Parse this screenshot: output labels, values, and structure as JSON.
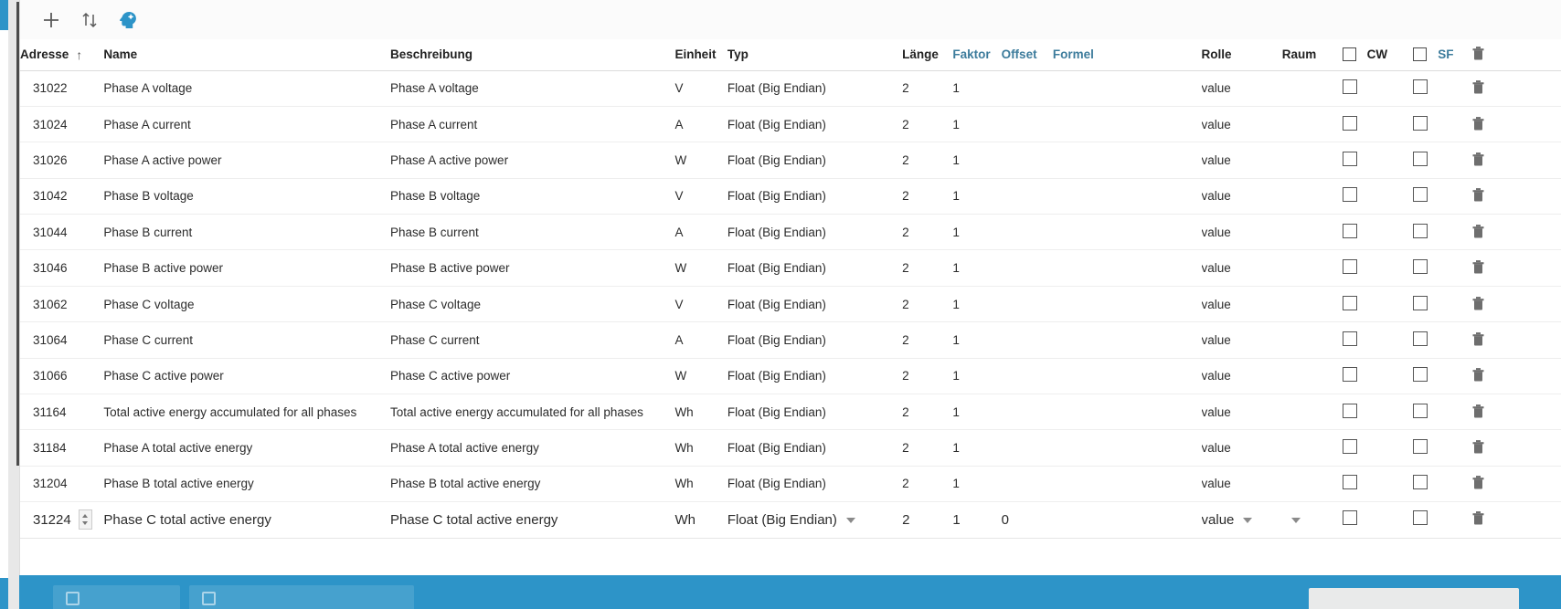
{
  "toolbar": {
    "add_label": "+",
    "sort_label": "sort-updown",
    "ai_label": "ai-head"
  },
  "table": {
    "headers": {
      "adresse": "Adresse",
      "name": "Name",
      "beschreibung": "Beschreibung",
      "einheit": "Einheit",
      "typ": "Typ",
      "laenge": "Länge",
      "faktor": "Faktor",
      "offset": "Offset",
      "formel": "Formel",
      "rolle": "Rolle",
      "raum": "Raum",
      "cw": "CW",
      "sf": "SF",
      "sort_indicator": "↑"
    },
    "rows": [
      {
        "adresse": "31022",
        "name": "Phase A voltage",
        "beschreibung": "Phase A voltage",
        "einheit": "V",
        "typ": "Float (Big Endian)",
        "laenge": "2",
        "faktor": "1",
        "offset": "",
        "formel": "",
        "rolle": "value",
        "raum": ""
      },
      {
        "adresse": "31024",
        "name": "Phase A current",
        "beschreibung": "Phase A current",
        "einheit": "A",
        "typ": "Float (Big Endian)",
        "laenge": "2",
        "faktor": "1",
        "offset": "",
        "formel": "",
        "rolle": "value",
        "raum": ""
      },
      {
        "adresse": "31026",
        "name": "Phase A active power",
        "beschreibung": "Phase A active power",
        "einheit": "W",
        "typ": "Float (Big Endian)",
        "laenge": "2",
        "faktor": "1",
        "offset": "",
        "formel": "",
        "rolle": "value",
        "raum": ""
      },
      {
        "adresse": "31042",
        "name": "Phase B voltage",
        "beschreibung": "Phase B voltage",
        "einheit": "V",
        "typ": "Float (Big Endian)",
        "laenge": "2",
        "faktor": "1",
        "offset": "",
        "formel": "",
        "rolle": "value",
        "raum": ""
      },
      {
        "adresse": "31044",
        "name": "Phase B current",
        "beschreibung": "Phase B current",
        "einheit": "A",
        "typ": "Float (Big Endian)",
        "laenge": "2",
        "faktor": "1",
        "offset": "",
        "formel": "",
        "rolle": "value",
        "raum": ""
      },
      {
        "adresse": "31046",
        "name": "Phase B active power",
        "beschreibung": "Phase B active power",
        "einheit": "W",
        "typ": "Float (Big Endian)",
        "laenge": "2",
        "faktor": "1",
        "offset": "",
        "formel": "",
        "rolle": "value",
        "raum": ""
      },
      {
        "adresse": "31062",
        "name": "Phase C voltage",
        "beschreibung": "Phase C voltage",
        "einheit": "V",
        "typ": "Float (Big Endian)",
        "laenge": "2",
        "faktor": "1",
        "offset": "",
        "formel": "",
        "rolle": "value",
        "raum": ""
      },
      {
        "adresse": "31064",
        "name": "Phase C current",
        "beschreibung": "Phase C current",
        "einheit": "A",
        "typ": "Float (Big Endian)",
        "laenge": "2",
        "faktor": "1",
        "offset": "",
        "formel": "",
        "rolle": "value",
        "raum": ""
      },
      {
        "adresse": "31066",
        "name": "Phase C active power",
        "beschreibung": "Phase C active power",
        "einheit": "W",
        "typ": "Float (Big Endian)",
        "laenge": "2",
        "faktor": "1",
        "offset": "",
        "formel": "",
        "rolle": "value",
        "raum": ""
      },
      {
        "adresse": "31164",
        "name": "Total active energy accumulated for all phases",
        "beschreibung": "Total active energy accumulated for all phases",
        "einheit": "Wh",
        "typ": "Float (Big Endian)",
        "laenge": "2",
        "faktor": "1",
        "offset": "",
        "formel": "",
        "rolle": "value",
        "raum": ""
      },
      {
        "adresse": "31184",
        "name": "Phase A total active energy",
        "beschreibung": "Phase A total active energy",
        "einheit": "Wh",
        "typ": "Float (Big Endian)",
        "laenge": "2",
        "faktor": "1",
        "offset": "",
        "formel": "",
        "rolle": "value",
        "raum": ""
      },
      {
        "adresse": "31204",
        "name": "Phase B total active energy",
        "beschreibung": "Phase B total active energy",
        "einheit": "Wh",
        "typ": "Float (Big Endian)",
        "laenge": "2",
        "faktor": "1",
        "offset": "",
        "formel": "",
        "rolle": "value",
        "raum": ""
      }
    ],
    "active_row": {
      "adresse": "31224",
      "name": "Phase C total active energy",
      "beschreibung": "Phase C total active energy",
      "einheit": "Wh",
      "typ": "Float (Big Endian)",
      "laenge": "2",
      "faktor": "1",
      "offset": "0",
      "formel": "",
      "rolle": "value",
      "raum": ""
    }
  },
  "colors": {
    "accent": "#2d94c8",
    "header_link": "#3d7c9c",
    "text": "#2b2b2b",
    "muted": "#b3b3b3"
  }
}
